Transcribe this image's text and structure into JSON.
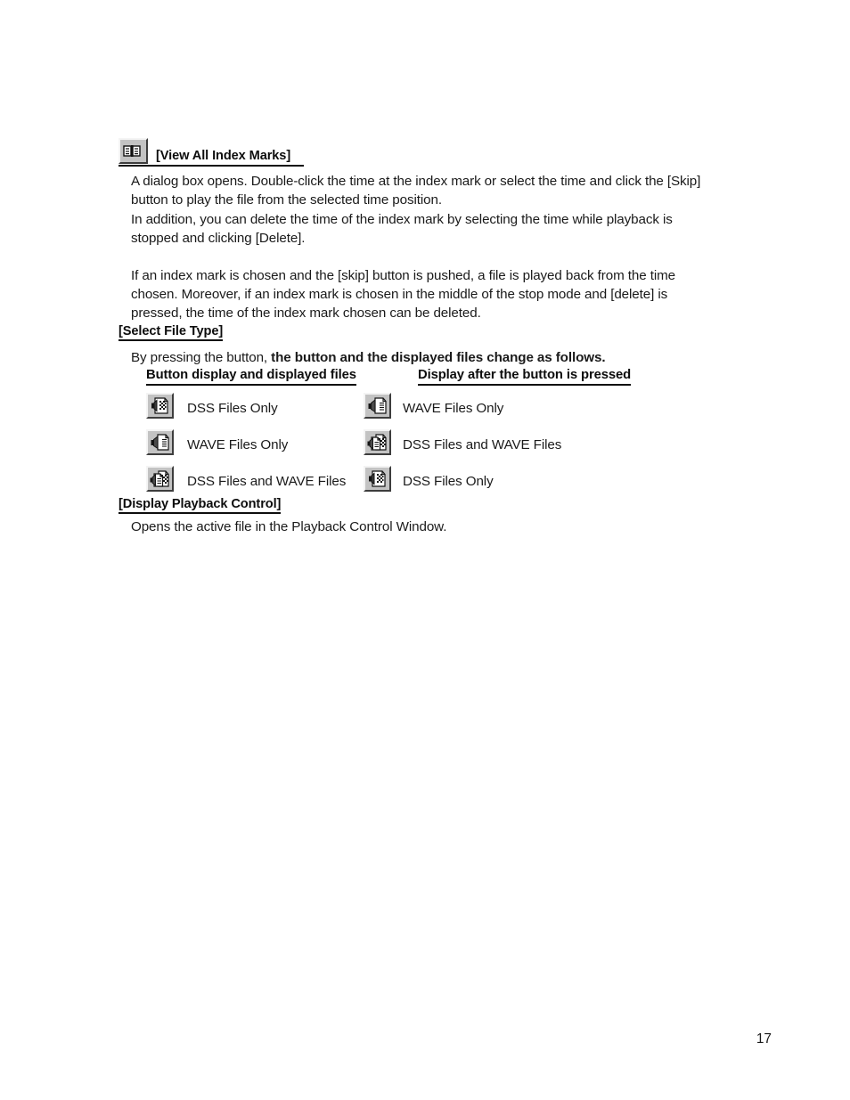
{
  "document": {
    "page_number": "17",
    "sections": {
      "view_all_index_marks": {
        "icon": "open-book-icon",
        "heading": "[View All Index Marks]",
        "paragraphs": [
          "A dialog box opens.  Double-click the time at the index mark or select the time and click the [Skip] button to play the file from the selected time position.",
          "In addition, you can delete the time of the index mark by selecting the time while playback is stopped and clicking [Delete].",
          "If an index mark is chosen and the [skip] button is pushed, a file is played back from the time chosen. Moreover, if an index mark is chosen in the middle of the stop mode and [delete] is pressed, the time of the index mark chosen can be deleted."
        ]
      },
      "select_file_type": {
        "heading": "[Select File Type]",
        "intro_plain": "By pressing the button, ",
        "intro_bold": "the button and the displayed files change as follows.",
        "column_headers": {
          "left": "Button display and displayed files",
          "right": "Display after the button is pressed"
        },
        "rows": [
          {
            "current_icon": "dss-files-only-icon",
            "current_label": "DSS Files Only",
            "pressed_icon": "wave-files-only-icon",
            "pressed_label": "WAVE Files Only"
          },
          {
            "current_icon": "wave-files-only-icon",
            "current_label": "WAVE Files Only",
            "pressed_icon": "dss-and-wave-files-icon",
            "pressed_label": "DSS Files and WAVE Files"
          },
          {
            "current_icon": "dss-and-wave-files-icon",
            "current_label": "DSS Files and WAVE Files",
            "pressed_icon": "dss-files-only-icon",
            "pressed_label": "DSS Files Only"
          }
        ]
      },
      "display_playback_control": {
        "heading": "[Display Playback Control]",
        "paragraph": "Opens the active file in the Playback Control Window."
      }
    },
    "colors": {
      "text": "#1a1a1a",
      "button_face": "#c3c3c3",
      "button_highlight": "#f4f4f4",
      "button_shadow": "#3d3d3d",
      "page_background": "#ffffff"
    }
  }
}
